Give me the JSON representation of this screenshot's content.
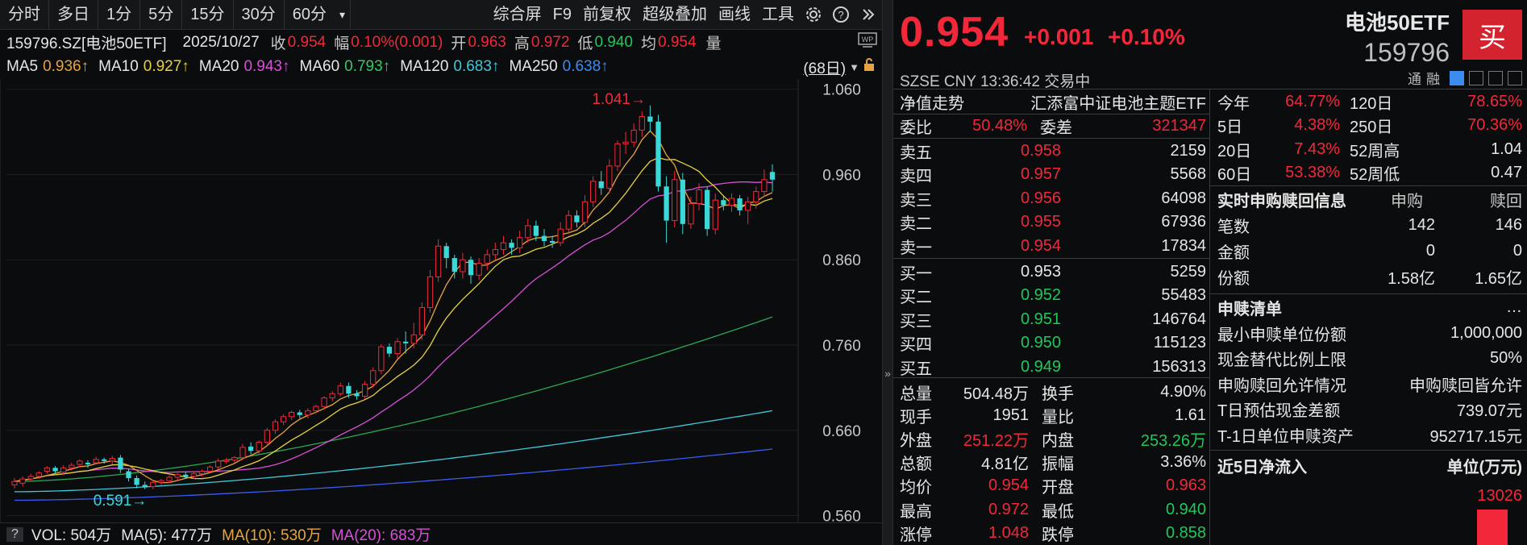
{
  "toolbar": {
    "tabs": [
      "分时",
      "多日",
      "1分",
      "5分",
      "15分",
      "30分",
      "60分"
    ],
    "dropdown": "▾",
    "right_items": [
      "综合屏",
      "F9",
      "前复权",
      "超级叠加",
      "画线",
      "工具"
    ],
    "icons": [
      "gear-icon",
      "help-icon",
      "collapse-icon"
    ]
  },
  "info": {
    "code": "159796.SZ[电池50ETF]",
    "date": "2025/10/27",
    "close_label": "收",
    "close": "0.954",
    "range_label": "幅",
    "range": "0.10%(0.001)",
    "open_label": "开",
    "open": "0.963",
    "high_label": "高",
    "high": "0.972",
    "low_label": "低",
    "low": "0.940",
    "avg_label": "均",
    "avg": "0.954",
    "vol_label": "量"
  },
  "ma": {
    "ma5_label": "MA5",
    "ma5": "0.936↑",
    "ma10_label": "MA10",
    "ma10": "0.927↑",
    "ma20_label": "MA20",
    "ma20": "0.943↑",
    "ma60_label": "MA60",
    "ma60": "0.793↑",
    "ma120_label": "MA120",
    "ma120": "0.683↑",
    "ma250_label": "MA250",
    "ma250": "0.638↑",
    "days": "(68日)"
  },
  "chart_data": {
    "type": "candlestick",
    "y_ticks": [
      "1.060",
      "0.960",
      "0.860",
      "0.760",
      "0.660",
      "0.560"
    ],
    "ylim": [
      0.552,
      1.072
    ],
    "high_marker": "1.041",
    "low_marker": "0.591",
    "candles": [
      [
        0.596,
        0.6,
        0.592,
        0.604
      ],
      [
        0.598,
        0.603,
        0.594,
        0.606
      ],
      [
        0.603,
        0.606,
        0.6,
        0.609
      ],
      [
        0.606,
        0.61,
        0.603,
        0.612
      ],
      [
        0.612,
        0.616,
        0.609,
        0.618
      ],
      [
        0.616,
        0.612,
        0.609,
        0.618
      ],
      [
        0.611,
        0.616,
        0.608,
        0.619
      ],
      [
        0.616,
        0.619,
        0.613,
        0.622
      ],
      [
        0.62,
        0.624,
        0.617,
        0.626
      ],
      [
        0.622,
        0.62,
        0.616,
        0.625
      ],
      [
        0.622,
        0.626,
        0.62,
        0.629
      ],
      [
        0.626,
        0.624,
        0.621,
        0.628
      ],
      [
        0.624,
        0.627,
        0.62,
        0.63
      ],
      [
        0.628,
        0.614,
        0.61,
        0.631
      ],
      [
        0.612,
        0.604,
        0.6,
        0.615
      ],
      [
        0.604,
        0.596,
        0.592,
        0.607
      ],
      [
        0.596,
        0.593,
        0.591,
        0.6
      ],
      [
        0.594,
        0.599,
        0.591,
        0.602
      ],
      [
        0.599,
        0.601,
        0.596,
        0.603
      ],
      [
        0.601,
        0.605,
        0.598,
        0.607
      ],
      [
        0.605,
        0.608,
        0.602,
        0.61
      ],
      [
        0.608,
        0.606,
        0.603,
        0.611
      ],
      [
        0.606,
        0.609,
        0.603,
        0.612
      ],
      [
        0.609,
        0.612,
        0.606,
        0.614
      ],
      [
        0.612,
        0.617,
        0.61,
        0.619
      ],
      [
        0.617,
        0.624,
        0.614,
        0.627
      ],
      [
        0.624,
        0.625,
        0.621,
        0.628
      ],
      [
        0.625,
        0.628,
        0.622,
        0.63
      ],
      [
        0.628,
        0.64,
        0.625,
        0.644
      ],
      [
        0.641,
        0.636,
        0.632,
        0.646
      ],
      [
        0.636,
        0.646,
        0.632,
        0.648
      ],
      [
        0.646,
        0.66,
        0.642,
        0.663
      ],
      [
        0.66,
        0.67,
        0.656,
        0.673
      ],
      [
        0.67,
        0.676,
        0.666,
        0.679
      ],
      [
        0.676,
        0.681,
        0.672,
        0.683
      ],
      [
        0.681,
        0.678,
        0.674,
        0.684
      ],
      [
        0.678,
        0.683,
        0.674,
        0.686
      ],
      [
        0.683,
        0.688,
        0.68,
        0.69
      ],
      [
        0.688,
        0.698,
        0.684,
        0.7
      ],
      [
        0.698,
        0.703,
        0.694,
        0.706
      ],
      [
        0.703,
        0.712,
        0.7,
        0.716
      ],
      [
        0.712,
        0.703,
        0.698,
        0.716
      ],
      [
        0.703,
        0.7,
        0.696,
        0.707
      ],
      [
        0.7,
        0.714,
        0.697,
        0.718
      ],
      [
        0.714,
        0.73,
        0.71,
        0.734
      ],
      [
        0.73,
        0.758,
        0.726,
        0.761
      ],
      [
        0.758,
        0.75,
        0.746,
        0.762
      ],
      [
        0.75,
        0.764,
        0.744,
        0.768
      ],
      [
        0.764,
        0.762,
        0.75,
        0.776
      ],
      [
        0.762,
        0.772,
        0.756,
        0.786
      ],
      [
        0.772,
        0.804,
        0.766,
        0.81
      ],
      [
        0.804,
        0.84,
        0.798,
        0.848
      ],
      [
        0.84,
        0.876,
        0.834,
        0.884
      ],
      [
        0.876,
        0.862,
        0.85,
        0.88
      ],
      [
        0.862,
        0.846,
        0.838,
        0.866
      ],
      [
        0.846,
        0.86,
        0.838,
        0.868
      ],
      [
        0.86,
        0.842,
        0.832,
        0.864
      ],
      [
        0.842,
        0.856,
        0.836,
        0.862
      ],
      [
        0.856,
        0.866,
        0.848,
        0.872
      ],
      [
        0.866,
        0.872,
        0.86,
        0.88
      ],
      [
        0.872,
        0.88,
        0.866,
        0.888
      ],
      [
        0.88,
        0.874,
        0.866,
        0.884
      ],
      [
        0.874,
        0.886,
        0.868,
        0.894
      ],
      [
        0.886,
        0.9,
        0.88,
        0.908
      ],
      [
        0.9,
        0.888,
        0.882,
        0.906
      ],
      [
        0.888,
        0.882,
        0.876,
        0.896
      ],
      [
        0.882,
        0.88,
        0.874,
        0.888
      ],
      [
        0.88,
        0.896,
        0.876,
        0.904
      ],
      [
        0.896,
        0.912,
        0.89,
        0.918
      ],
      [
        0.912,
        0.904,
        0.898,
        0.918
      ],
      [
        0.904,
        0.928,
        0.898,
        0.936
      ],
      [
        0.928,
        0.952,
        0.922,
        0.958
      ],
      [
        0.952,
        0.944,
        0.936,
        0.964
      ],
      [
        0.944,
        0.97,
        0.938,
        0.978
      ],
      [
        0.97,
        0.996,
        0.964,
        1.0
      ],
      [
        0.996,
        0.998,
        0.984,
        1.01
      ],
      [
        0.998,
        1.012,
        0.992,
        1.02
      ],
      [
        1.012,
        1.028,
        1.004,
        1.034
      ],
      [
        1.028,
        1.022,
        1.01,
        1.041
      ],
      [
        1.022,
        0.946,
        0.94,
        1.03
      ],
      [
        0.946,
        0.906,
        0.88,
        0.958
      ],
      [
        0.906,
        0.954,
        0.898,
        0.964
      ],
      [
        0.954,
        0.902,
        0.89,
        0.962
      ],
      [
        0.902,
        0.926,
        0.896,
        0.934
      ],
      [
        0.926,
        0.942,
        0.918,
        0.95
      ],
      [
        0.942,
        0.896,
        0.888,
        0.946
      ],
      [
        0.896,
        0.93,
        0.89,
        0.938
      ],
      [
        0.93,
        0.924,
        0.918,
        0.934
      ],
      [
        0.924,
        0.932,
        0.916,
        0.938
      ],
      [
        0.932,
        0.918,
        0.912,
        0.936
      ],
      [
        0.918,
        0.928,
        0.902,
        0.934
      ],
      [
        0.928,
        0.94,
        0.92,
        0.946
      ],
      [
        0.94,
        0.954,
        0.934,
        0.966
      ],
      [
        0.963,
        0.954,
        0.94,
        0.972
      ]
    ]
  },
  "volbar": {
    "q": "?",
    "vol": "VOL: 504万",
    "ma5": "MA(5): 477万",
    "ma10": "MA(10): 530万",
    "ma20": "MA(20): 683万"
  },
  "quote": {
    "price": "0.954",
    "change": "+0.001",
    "pct": "+0.10%",
    "name": "电池50ETF",
    "code": "159796",
    "buy": "买",
    "tags": [
      "通",
      "融"
    ],
    "status": "SZSE  CNY  13:36:42  交易中"
  },
  "nav": {
    "label": "净值走势",
    "fund": "汇添富中证电池主题ETF"
  },
  "weibi": {
    "label1": "委比",
    "val1": "50.48%",
    "label2": "委差",
    "val2": "321347"
  },
  "asks": [
    {
      "l": "卖五",
      "p": "0.958",
      "v": "2159"
    },
    {
      "l": "卖四",
      "p": "0.957",
      "v": "5568"
    },
    {
      "l": "卖三",
      "p": "0.956",
      "v": "64098"
    },
    {
      "l": "卖二",
      "p": "0.955",
      "v": "67936"
    },
    {
      "l": "卖一",
      "p": "0.954",
      "v": "17834"
    }
  ],
  "bids": [
    {
      "l": "买一",
      "p": "0.953",
      "v": "5259"
    },
    {
      "l": "买二",
      "p": "0.952",
      "v": "55483"
    },
    {
      "l": "买三",
      "p": "0.951",
      "v": "146764"
    },
    {
      "l": "买四",
      "p": "0.950",
      "v": "115123"
    },
    {
      "l": "买五",
      "p": "0.949",
      "v": "156313"
    }
  ],
  "stats": [
    {
      "l1": "总量",
      "v1": "504.48万",
      "c1": "wht",
      "l2": "换手",
      "v2": "4.90%",
      "c2": "wht"
    },
    {
      "l1": "现手",
      "v1": "1951",
      "c1": "wht",
      "l2": "量比",
      "v2": "1.61",
      "c2": "wht"
    },
    {
      "l1": "外盘",
      "v1": "251.22万",
      "c1": "red",
      "l2": "内盘",
      "v2": "253.26万",
      "c2": "green"
    },
    {
      "l1": "总额",
      "v1": "4.81亿",
      "c1": "wht",
      "l2": "振幅",
      "v2": "3.36%",
      "c2": "wht"
    },
    {
      "l1": "均价",
      "v1": "0.954",
      "c1": "red",
      "l2": "开盘",
      "v2": "0.963",
      "c2": "red"
    },
    {
      "l1": "最高",
      "v1": "0.972",
      "c1": "red",
      "l2": "最低",
      "v2": "0.940",
      "c2": "green"
    },
    {
      "l1": "涨停",
      "v1": "1.048",
      "c1": "red",
      "l2": "跌停",
      "v2": "0.858",
      "c2": "green"
    }
  ],
  "perf": [
    {
      "l1": "今年",
      "v1": "64.77%",
      "l2": "120日",
      "v2": "78.65%",
      "c2": "red"
    },
    {
      "l1": "5日",
      "v1": "4.38%",
      "l2": "250日",
      "v2": "70.36%",
      "c2": "red"
    },
    {
      "l1": "20日",
      "v1": "7.43%",
      "l2": "52周高",
      "v2": "1.04",
      "c2": "wht"
    },
    {
      "l1": "60日",
      "v1": "53.38%",
      "l2": "52周低",
      "v2": "0.47",
      "c2": "wht"
    }
  ],
  "redemption": {
    "title": "实时申购赎回信息",
    "col1": "申购",
    "col2": "赎回",
    "rows": [
      {
        "l": "笔数",
        "a": "142",
        "b": "146"
      },
      {
        "l": "金额",
        "a": "0",
        "b": "0"
      },
      {
        "l": "份额",
        "a": "1.58亿",
        "b": "1.65亿"
      }
    ]
  },
  "list": {
    "title": "申赎清单",
    "more": "…",
    "rows": [
      {
        "l": "最小申赎单位份额",
        "v": "1,000,000"
      },
      {
        "l": "现金替代比例上限",
        "v": "50%"
      },
      {
        "l": "申购赎回允许情况",
        "v": "申购赎回皆允许"
      },
      {
        "l": "T日预估现金差额",
        "v": "739.07元"
      },
      {
        "l": "T-1日单位申赎资产",
        "v": "952717.15元"
      }
    ]
  },
  "flow": {
    "title": "近5日净流入",
    "unit": "单位(万元)",
    "value": "13026"
  }
}
